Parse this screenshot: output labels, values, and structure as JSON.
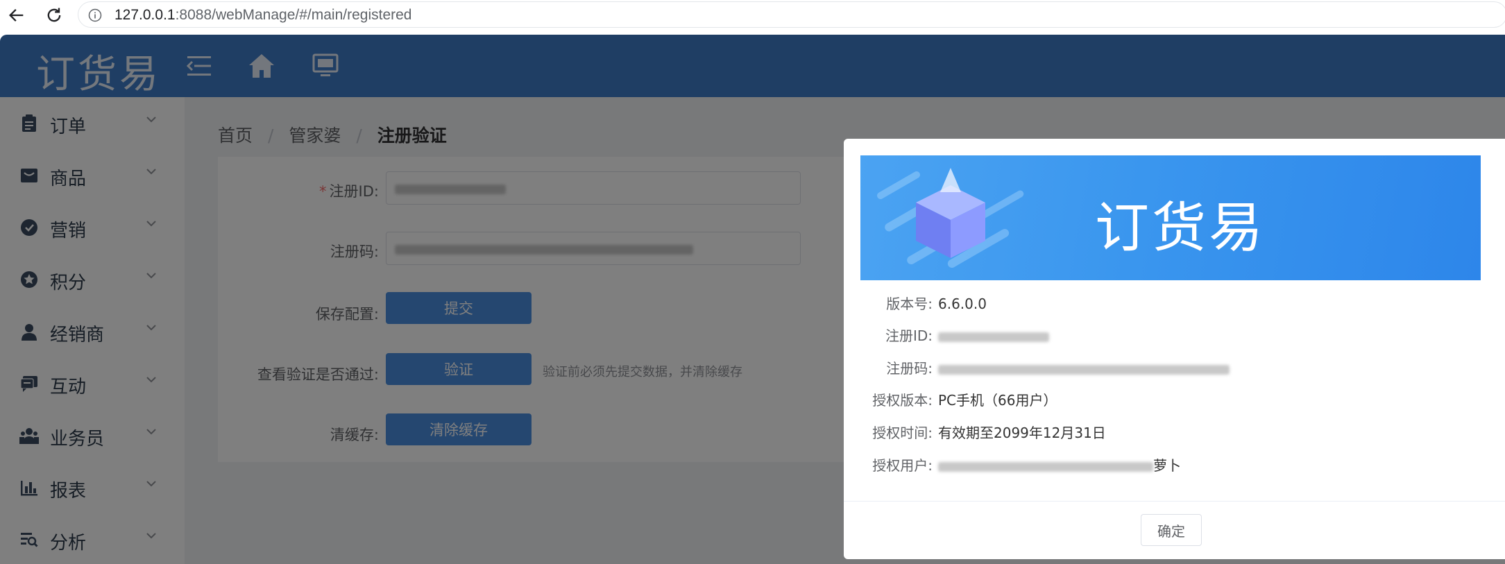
{
  "browser": {
    "url_host": "127.0.0.1",
    "url_path": ":8088/webManage/#/main/registered"
  },
  "app": {
    "logo_text": "订货易",
    "header_bg": "#3f7cc8"
  },
  "sidebar": {
    "items": [
      {
        "label": "订单",
        "icon": "clipboard-icon"
      },
      {
        "label": "商品",
        "icon": "shopping-box-icon"
      },
      {
        "label": "营销",
        "icon": "badge-icon"
      },
      {
        "label": "积分",
        "icon": "star-icon"
      },
      {
        "label": "经销商",
        "icon": "user-icon"
      },
      {
        "label": "互动",
        "icon": "chat-icon"
      },
      {
        "label": "业务员",
        "icon": "team-icon"
      },
      {
        "label": "报表",
        "icon": "bar-chart-icon"
      },
      {
        "label": "分析",
        "icon": "analysis-icon"
      }
    ]
  },
  "breadcrumb": {
    "home": "首页",
    "parent": "管家婆",
    "current": "注册验证",
    "separator": "/"
  },
  "form": {
    "reg_id_label": "注册ID:",
    "reg_id_required_mark": "*",
    "reg_code_label": "注册码:",
    "save_config_label": "保存配置:",
    "submit_button": "提交",
    "verify_label": "查看验证是否通过:",
    "verify_button": "验证",
    "verify_hint": "验证前必须先提交数据，并清除缓存",
    "clear_cache_label": "清缓存:",
    "clear_cache_button": "清除缓存"
  },
  "dialog": {
    "banner_logo": "订货易",
    "version_label": "版本号:",
    "version_value": "6.6.0.0",
    "reg_id_label": "注册ID:",
    "reg_code_label": "注册码:",
    "license_edition_label": "授权版本:",
    "license_edition_value": "PC手机（66用户）",
    "license_time_label": "授权时间:",
    "license_time_value": "有效期至2099年12月31日",
    "license_user_label": "授权用户:",
    "license_user_value_suffix": "萝卜",
    "ok_button": "确定",
    "accent_color": "#3a96ee"
  }
}
